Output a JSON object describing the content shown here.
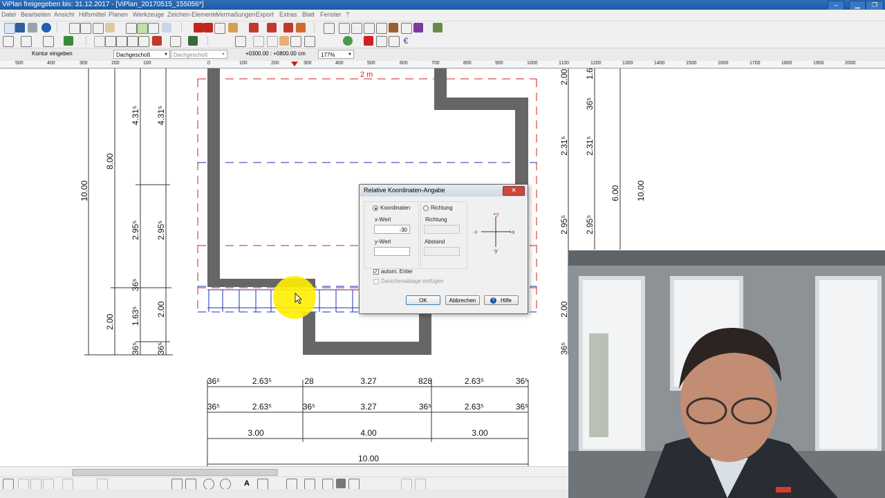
{
  "titlebar": {
    "title": "ViPlan freigegeben bis: 31.12.2017 - [ViPlan_20170515_155056*]"
  },
  "menu": [
    "Datei",
    "Bearbeiten",
    "Ansicht",
    "Hilfsmittel",
    "Planen",
    "Werkzeuge",
    "Zeichen-Elemente",
    "Vermaßungen",
    "Export",
    "Extras",
    "Blatt",
    "Fenster",
    "?"
  ],
  "inputbar": {
    "command": "Kontur eingeben",
    "floor1": "Dachgeschoß",
    "floor2": "Dachgeschoß",
    "coords": "+0300.00 : +0800.00 cm",
    "zoom": "177%"
  },
  "ruler": {
    "labels": [
      "500",
      "400",
      "300",
      "200",
      "100",
      "0",
      "100",
      "200",
      "300",
      "400",
      "500",
      "600",
      "700",
      "800",
      "900",
      "1000",
      "1100",
      "1200",
      "1300",
      "1400",
      "1500",
      "1600",
      "1700",
      "1800",
      "1900",
      "2000"
    ]
  },
  "drawing": {
    "top_label": "2 m",
    "vertical_dims": [
      "10.00",
      "8.00",
      "4.31⁵",
      "4.31⁵",
      "2.95⁵",
      "2.95⁵",
      "36⁵",
      "1.63⁵",
      "2.00",
      "2.00",
      "36⁵",
      "36⁵",
      "2.00",
      "2.31⁵",
      "2.31⁵",
      "2.95⁵",
      "2.95⁵",
      "2.00",
      "36⁵",
      "1.6",
      "36⁵",
      "6.00",
      "10.00"
    ],
    "horizontal_dims": {
      "row1": [
        "36⁵",
        "2.63⁵",
        "28",
        "3.27",
        "828",
        "2.63⁵",
        "36⁵"
      ],
      "row2": [
        "36⁵",
        "2.63⁵",
        "36⁵",
        "3.27",
        "36⁵",
        "2.63⁵",
        "36⁵"
      ],
      "row3": [
        "3.00",
        "4.00",
        "3.00"
      ],
      "row4": [
        "10.00"
      ]
    }
  },
  "dialog": {
    "title": "Relative Koordinaten-Angabe",
    "close": "✕",
    "radio_coords": "Koordinaten",
    "radio_direction": "Richtung",
    "x_label": "x-Wert",
    "x_value": "-30",
    "y_label": "y-Wert",
    "y_value": "",
    "direction_label": "Richtung",
    "distance_label": "Abstand",
    "auto_enter": "autom. Enter",
    "clipboard": "Zwischenablage einfügen",
    "ok": "OK",
    "cancel": "Abbrechen",
    "help": "Hilfe",
    "axis": {
      "plus_y": "+y",
      "minus_y": "-y",
      "plus_x": "+x",
      "minus_x": "-x"
    }
  },
  "colors": {
    "titlebar": "#1e5aa3",
    "wall": "#666666",
    "red_line": "#cc1f1f",
    "blue_line": "#1f2fb0",
    "highlight": "#ffee00"
  }
}
